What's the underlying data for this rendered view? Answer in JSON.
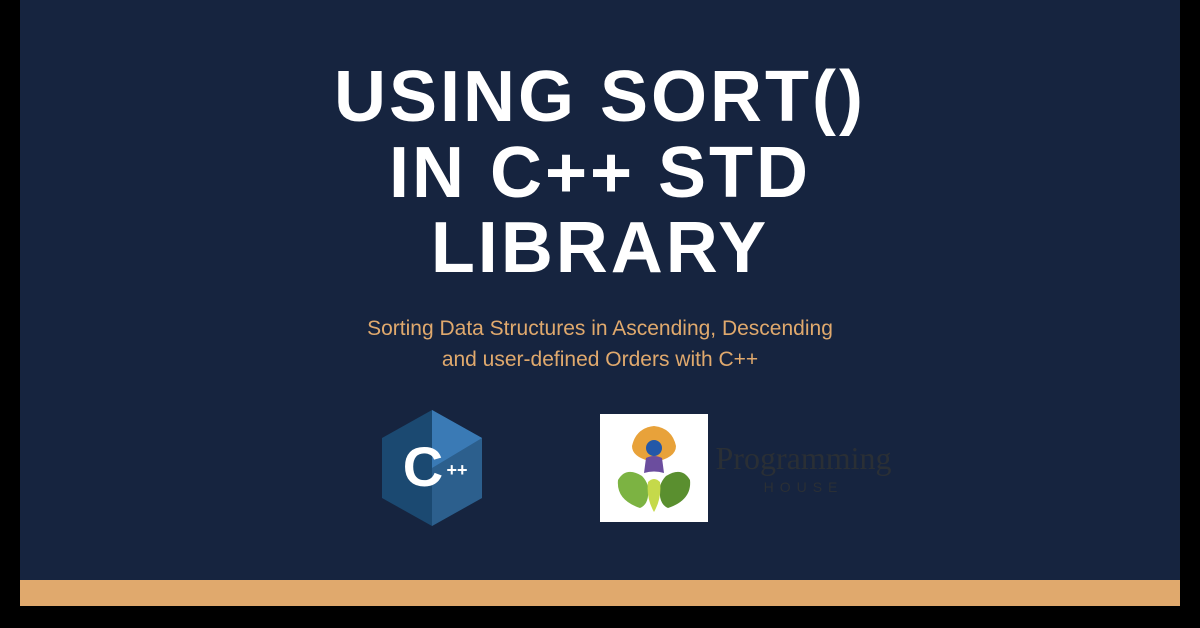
{
  "colors": {
    "background": "#16243f",
    "accent": "#e0a96d",
    "title": "#ffffff"
  },
  "title": {
    "line1": "USING SORT()",
    "line2": "IN C++ STD",
    "line3": "LIBRARY"
  },
  "subtitle": {
    "line1": "Sorting Data Structures in Ascending, Descending",
    "line2": "and user-defined Orders with C++"
  },
  "logos": {
    "cpp": {
      "letter": "C",
      "suffix": "++"
    },
    "programming_house": {
      "main": "Programming",
      "sub": "HOUSE"
    }
  }
}
